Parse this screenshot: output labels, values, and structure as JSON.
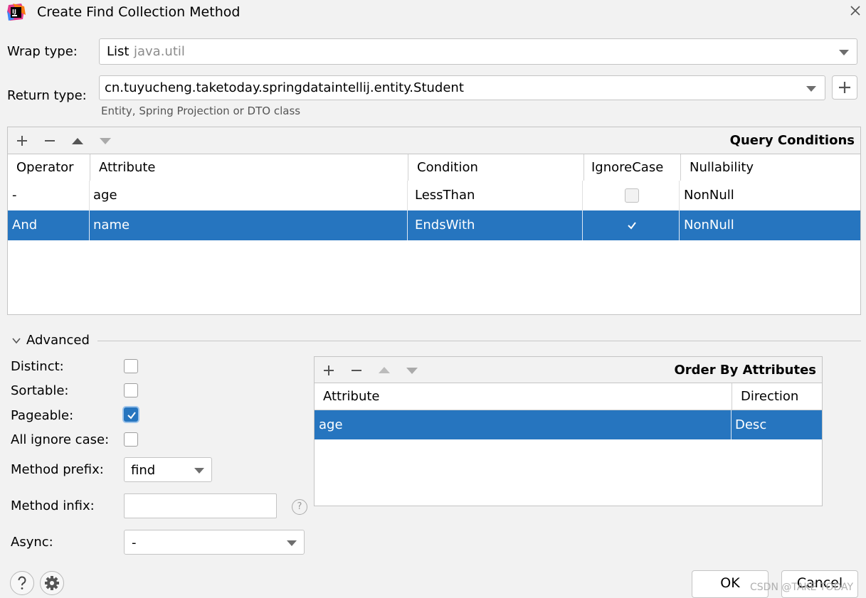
{
  "window": {
    "title": "Create Find Collection Method"
  },
  "wrap_type": {
    "label": "Wrap type:",
    "value": "List",
    "package": "java.util"
  },
  "return_type": {
    "label": "Return type:",
    "value": "cn.tuyucheng.taketoday.springdataintellij.entity.Student",
    "hint": "Entity, Spring Projection or DTO class"
  },
  "query_conditions": {
    "title": "Query Conditions",
    "columns": [
      "Operator",
      "Attribute",
      "Condition",
      "IgnoreCase",
      "Nullability"
    ],
    "rows": [
      {
        "operator": "-",
        "attribute": "age",
        "condition": "LessThan",
        "ignore_case": false,
        "nullability": "NonNull",
        "selected": false
      },
      {
        "operator": "And",
        "attribute": "name",
        "condition": "EndsWith",
        "ignore_case": true,
        "nullability": "NonNull",
        "selected": true
      }
    ]
  },
  "advanced": {
    "label": "Advanced",
    "distinct": {
      "label": "Distinct:",
      "checked": false
    },
    "sortable": {
      "label": "Sortable:",
      "checked": false
    },
    "pageable": {
      "label": "Pageable:",
      "checked": true
    },
    "all_ignore_case": {
      "label": "All ignore case:",
      "checked": false
    },
    "method_prefix": {
      "label": "Method prefix:",
      "value": "find"
    },
    "method_infix": {
      "label": "Method infix:",
      "value": ""
    },
    "async": {
      "label": "Async:",
      "value": "-"
    }
  },
  "order_by": {
    "title": "Order By Attributes",
    "columns": [
      "Attribute",
      "Direction"
    ],
    "rows": [
      {
        "attribute": "age",
        "direction": "Desc",
        "selected": true
      }
    ]
  },
  "buttons": {
    "ok": "OK",
    "cancel": "Cancel"
  },
  "watermark": "CSDN @TAKE TODAY",
  "colors": {
    "selection": "#2675bf",
    "background": "#f2f2f2"
  }
}
